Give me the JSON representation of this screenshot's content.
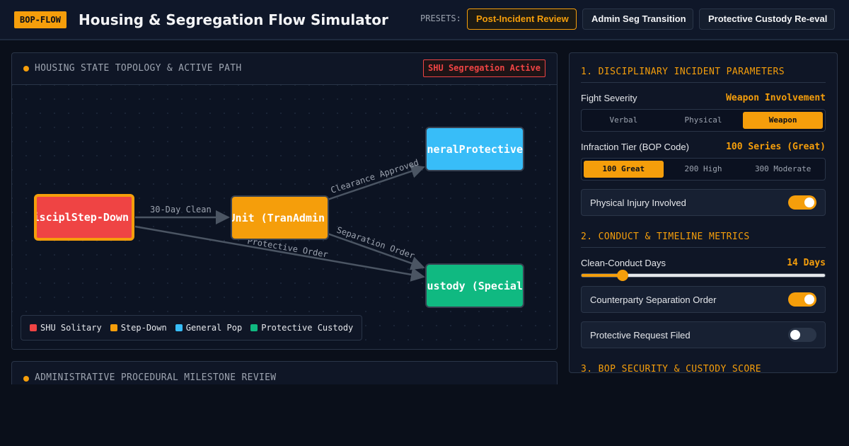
{
  "header": {
    "brand": "BOP-FLOW",
    "title": "Housing & Segregation Flow Simulator",
    "presets_label": "PRESETS:",
    "presets": [
      {
        "label": "Post-Incident Review",
        "active": true
      },
      {
        "label": "Admin Seg Transition",
        "active": false
      },
      {
        "label": "Protective Custody Re-eval",
        "active": false
      }
    ]
  },
  "topology": {
    "title": "HOUSING STATE TOPOLOGY & ACTIVE PATH",
    "badge": "SHU Segregation Active",
    "nodes": {
      "shu": {
        "label": "litary (DisciplStep-Down"
      },
      "stepdown": {
        "label": "wn Unit (TranAdmin"
      },
      "general": {
        "label": "Security GeneralProtective"
      },
      "protective": {
        "label": "ve Custody (Special"
      }
    },
    "edges": {
      "clean": "30-Day Clean",
      "clearance": "Clearance Approved",
      "separation": "Separation Order",
      "protective_order": "Protective Order"
    },
    "legend": [
      {
        "label": "SHU Solitary",
        "color": "#ef4444"
      },
      {
        "label": "Step-Down",
        "color": "#f59e0b"
      },
      {
        "label": "General Pop",
        "color": "#38bdf8"
      },
      {
        "label": "Protective Custody",
        "color": "#10b981"
      }
    ]
  },
  "milestones": {
    "title": "ADMINISTRATIVE PROCEDURAL MILESTONE REVIEW"
  },
  "controls": {
    "section1": "1. DISCIPLINARY INCIDENT PARAMETERS",
    "fight_severity": {
      "label": "Fight Severity",
      "value": "Weapon Involvement",
      "options": [
        "Verbal",
        "Physical",
        "Weapon"
      ],
      "selected": 2
    },
    "infraction_tier": {
      "label": "Infraction Tier (BOP Code)",
      "value": "100 Series (Great)",
      "options": [
        "100 Great",
        "200 High",
        "300 Moderate"
      ],
      "selected": 0
    },
    "physical_injury": {
      "label": "Physical Injury Involved",
      "on": true
    },
    "section2": "2. CONDUCT & TIMELINE METRICS",
    "clean_days": {
      "label": "Clean-Conduct Days",
      "value": "14 Days",
      "fraction": 0.17
    },
    "separation_order": {
      "label": "Counterparty Separation Order",
      "on": true
    },
    "protective_request": {
      "label": "Protective Request Filed",
      "on": false
    },
    "section3": "3. BOP SECURITY & CUSTODY SCORE"
  }
}
